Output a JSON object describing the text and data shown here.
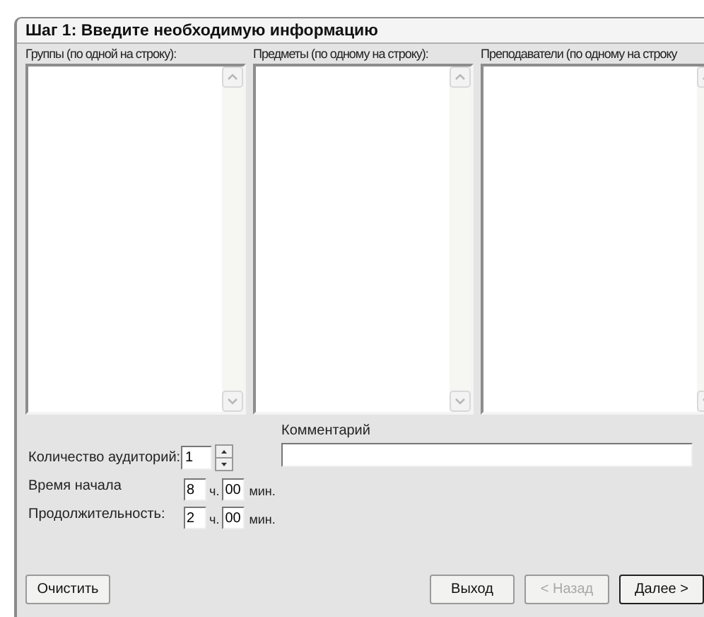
{
  "window": {
    "title": "Шаг 1: Введите необходимую информацию"
  },
  "lists": [
    {
      "label": "Группы (по одной на строку):"
    },
    {
      "label": "Предметы (по одному на строку):"
    },
    {
      "label": "Преподаватели (по одному на строку"
    }
  ],
  "rooms": {
    "label": "Количество аудиторий:",
    "value": "1"
  },
  "times": [
    {
      "label": "Время начала",
      "hours": "8",
      "hours_unit": "ч.",
      "minutes": "00",
      "minutes_unit": "мин."
    },
    {
      "label": "Продолжительность:",
      "hours": "2",
      "hours_unit": "ч.",
      "minutes": "00",
      "minutes_unit": "мин."
    }
  ],
  "comment": {
    "label": "Комментарий"
  },
  "buttons": [
    {
      "label": "Очистить",
      "disabled": false,
      "default": false
    },
    {
      "label": "Выход",
      "disabled": false,
      "default": false
    },
    {
      "label": "< Назад",
      "disabled": true,
      "default": false
    },
    {
      "label": "Далее >",
      "disabled": false,
      "default": true
    }
  ]
}
